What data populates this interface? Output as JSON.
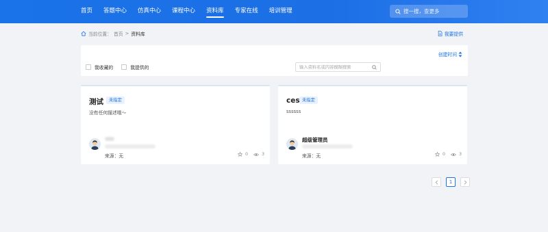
{
  "header": {
    "nav": [
      "首页",
      "答题中心",
      "仿真中心",
      "课程中心",
      "资料库",
      "专家在线",
      "培训管理"
    ],
    "active_nav": "资料库",
    "search_placeholder": "搜一搜，查更多"
  },
  "breadcrumb": {
    "prefix": "当前位置：",
    "home": "首页",
    "separator": ">",
    "current": "资料库"
  },
  "provide_label": "我要提供",
  "filter": {
    "sort_label": "创建时间",
    "checkboxes": [
      "我收藏的",
      "我提供的"
    ],
    "keyword_placeholder": "输入资料名或内容模糊搜索"
  },
  "cards": [
    {
      "title": "测试",
      "tag": "未指定",
      "description": "没有任何描述哦～",
      "author": "",
      "source": "来源：无",
      "favorites": "0",
      "views": "3"
    },
    {
      "title": "ces",
      "tag": "未指定",
      "description": "ssssss",
      "author": "超级管理员",
      "source": "来源：无",
      "favorites": "0",
      "views": "3"
    }
  ],
  "pagination": {
    "current_page": "1"
  },
  "colors": {
    "primary": "#1a73e8",
    "background": "#f2f3f6",
    "tag_bg": "#e8f1fd"
  },
  "icons": {
    "home": "home-icon",
    "search": "search-icon",
    "document": "document-icon",
    "sort": "sort-arrows-icon",
    "star": "star-icon",
    "eye": "eye-icon"
  }
}
